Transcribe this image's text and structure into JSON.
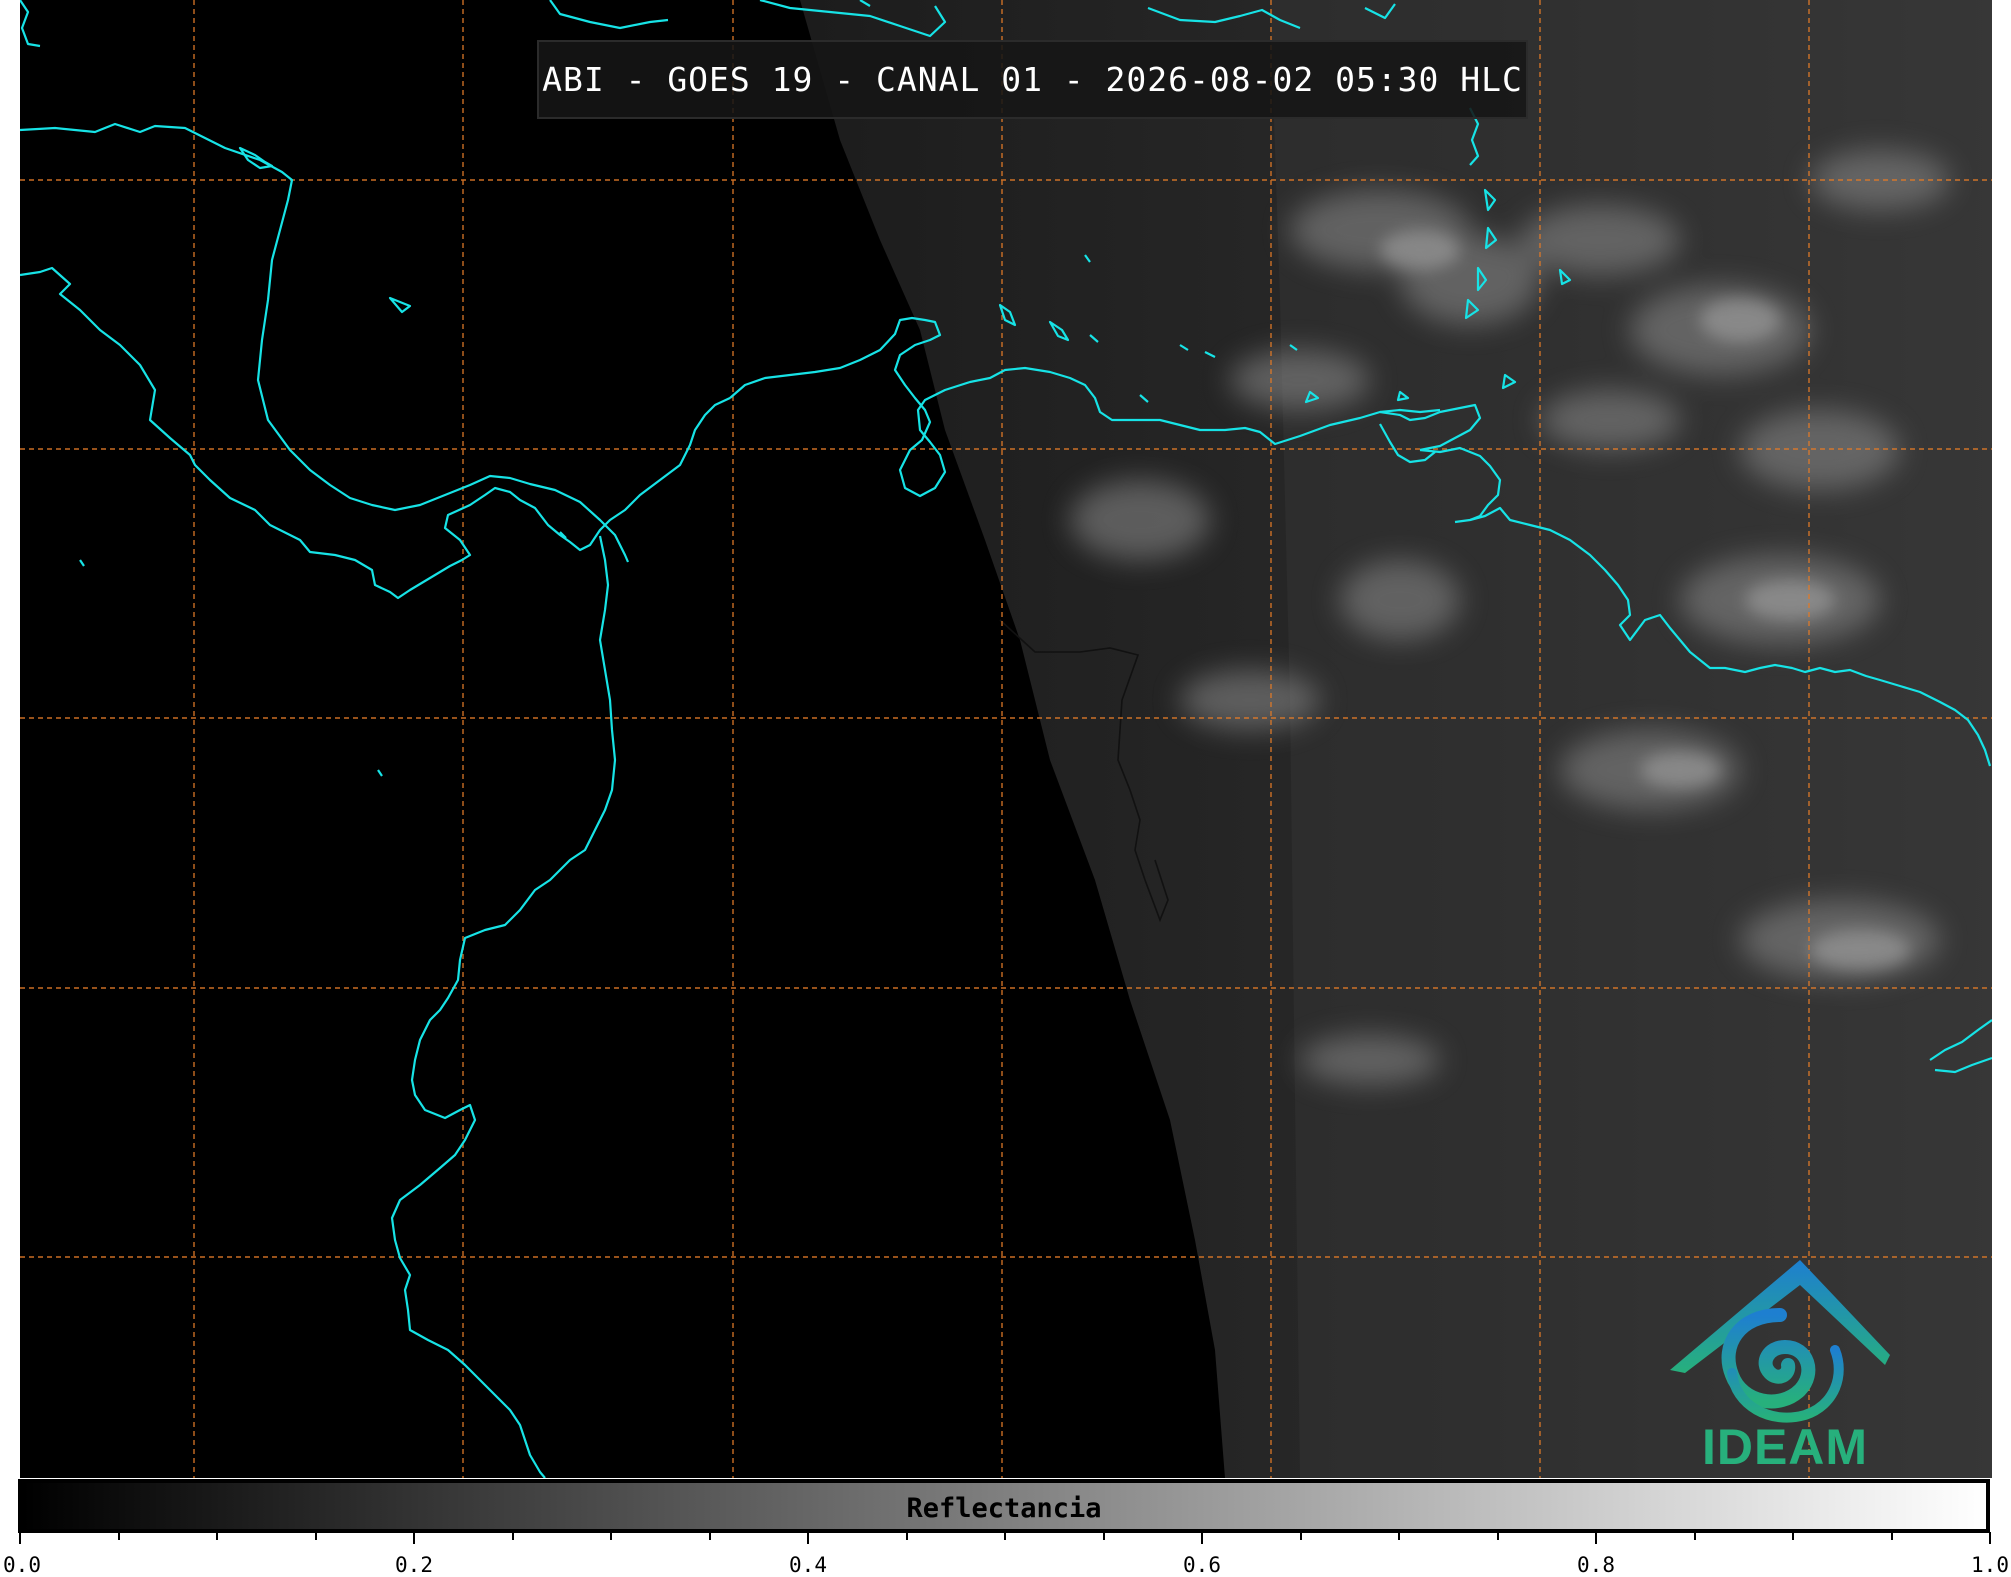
{
  "title": "ABI - GOES 19 - CANAL 01 - 2026-08-02 05:30 HLC",
  "colorbar": {
    "label": "Reflectancia",
    "ticks": [
      "0.0",
      "0.2",
      "0.4",
      "0.6",
      "0.8",
      "1.0"
    ],
    "range": [
      0.0,
      1.0
    ]
  },
  "logo": {
    "text": "IDEAM"
  },
  "colors": {
    "coastline": "#17e3e6",
    "grid": "#e07a28",
    "background_night": "#000000",
    "cloud": "#9a9a9a"
  }
}
